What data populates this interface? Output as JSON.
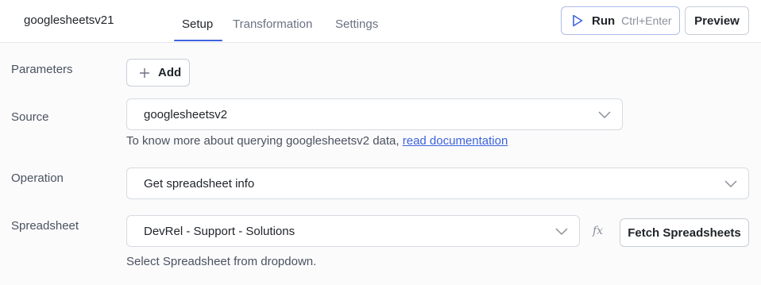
{
  "header": {
    "query_name": "googlesheetsv21",
    "tabs": [
      {
        "label": "Setup",
        "active": true
      },
      {
        "label": "Transformation",
        "active": false
      },
      {
        "label": "Settings",
        "active": false
      }
    ],
    "run": {
      "label": "Run",
      "shortcut": "Ctrl+Enter",
      "icon": "play-icon"
    },
    "preview_label": "Preview"
  },
  "form": {
    "parameters": {
      "label": "Parameters",
      "add_label": "Add",
      "add_icon": "plus-icon"
    },
    "source": {
      "label": "Source",
      "value": "googlesheetsv2",
      "hint_prefix": "To know more about querying googlesheetsv2 data,",
      "hint_link": "read documentation"
    },
    "operation": {
      "label": "Operation",
      "value": "Get spreadsheet info"
    },
    "spreadsheet": {
      "label": "Spreadsheet",
      "value": "DevRel - Support - Solutions",
      "fx_label": "fx",
      "fetch_label": "Fetch Spreadsheets",
      "hint": "Select Spreadsheet from dropdown."
    }
  },
  "colors": {
    "accent": "#3e63dd",
    "border": "#d6dae0",
    "text": "#1f2328",
    "muted": "#4b5260"
  }
}
